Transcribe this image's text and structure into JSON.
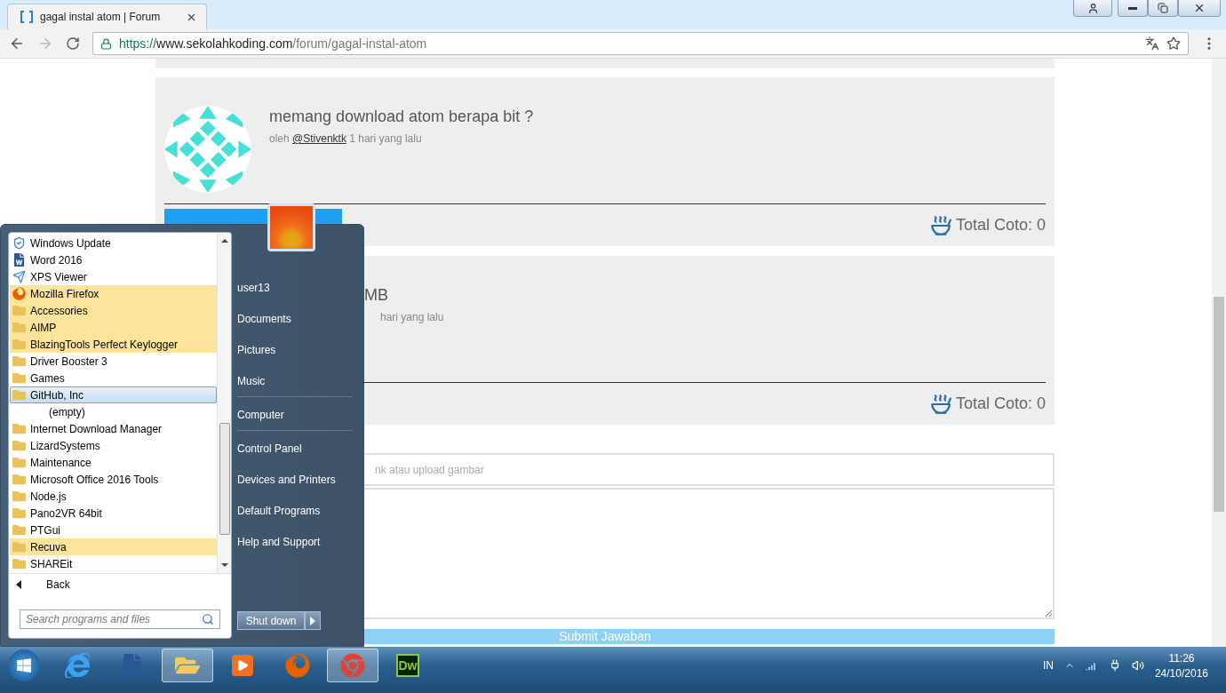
{
  "browser": {
    "tab": {
      "title": "gagal instal atom | Forum"
    },
    "url": {
      "scheme": "https://",
      "host": "www.sekolahkoding.com",
      "path": "/forum/gagal-instal-atom"
    }
  },
  "posts": [
    {
      "title": "memang download atom berapa bit ?",
      "by": "oleh",
      "author": "@Stivenktk",
      "time": "1 hari yang lalu",
      "coto": "Total Coto: 0"
    },
    {
      "title": "MB",
      "time": "hari yang lalu",
      "coto": "Total Coto: 0"
    }
  ],
  "reply_form": {
    "link_placeholder": "nk atau upload gambar",
    "submit": "Submit Jawaban"
  },
  "start_menu": {
    "programs": [
      {
        "label": "Windows Update",
        "kind": "update",
        "highlighted": false,
        "selected": false
      },
      {
        "label": "Word 2016",
        "kind": "word",
        "highlighted": false,
        "selected": false
      },
      {
        "label": "XPS Viewer",
        "kind": "xps",
        "highlighted": false,
        "selected": false
      },
      {
        "label": "Mozilla Firefox",
        "kind": "firefox",
        "highlighted": true,
        "selected": false
      },
      {
        "label": "Accessories",
        "kind": "folder",
        "highlighted": true,
        "selected": false
      },
      {
        "label": "AIMP",
        "kind": "folder",
        "highlighted": true,
        "selected": false
      },
      {
        "label": "BlazingTools Perfect Keylogger",
        "kind": "folder",
        "highlighted": true,
        "selected": false
      },
      {
        "label": "Driver Booster 3",
        "kind": "folder",
        "highlighted": false,
        "selected": false
      },
      {
        "label": "Games",
        "kind": "folder",
        "highlighted": false,
        "selected": false
      },
      {
        "label": "GitHub, Inc",
        "kind": "folder",
        "highlighted": false,
        "selected": true,
        "children": [
          {
            "label": "(empty)"
          }
        ]
      },
      {
        "label": "Internet Download Manager",
        "kind": "folder",
        "highlighted": false,
        "selected": false
      },
      {
        "label": "LizardSystems",
        "kind": "folder",
        "highlighted": false,
        "selected": false
      },
      {
        "label": "Maintenance",
        "kind": "folder",
        "highlighted": false,
        "selected": false
      },
      {
        "label": "Microsoft Office 2016 Tools",
        "kind": "folder",
        "highlighted": false,
        "selected": false
      },
      {
        "label": "Node.js",
        "kind": "folder",
        "highlighted": false,
        "selected": false
      },
      {
        "label": "Pano2VR 64bit",
        "kind": "folder",
        "highlighted": false,
        "selected": false
      },
      {
        "label": "PTGui",
        "kind": "folder",
        "highlighted": false,
        "selected": false
      },
      {
        "label": "Recuva",
        "kind": "folder",
        "highlighted": true,
        "selected": false
      },
      {
        "label": "SHAREit",
        "kind": "folder",
        "highlighted": false,
        "selected": false
      }
    ],
    "back": "Back",
    "search_placeholder": "Search programs and files",
    "places": [
      {
        "label": "user13",
        "separator_after": false
      },
      {
        "label": "Documents",
        "separator_after": false
      },
      {
        "label": "Pictures",
        "separator_after": false
      },
      {
        "label": "Music",
        "separator_after": true
      },
      {
        "label": "Computer",
        "separator_after": true
      },
      {
        "label": "Control Panel",
        "separator_after": false
      },
      {
        "label": "Devices and Printers",
        "separator_after": false
      },
      {
        "label": "Default Programs",
        "separator_after": false
      },
      {
        "label": "Help and Support",
        "separator_after": false
      }
    ],
    "shutdown": "Shut down"
  },
  "taskbar": {
    "apps": [
      {
        "kind": "ie",
        "active": false
      },
      {
        "kind": "word",
        "active": false
      },
      {
        "kind": "explorer",
        "active": true
      },
      {
        "kind": "media",
        "active": false
      },
      {
        "kind": "firefox",
        "active": false
      },
      {
        "kind": "chrome",
        "active": true
      },
      {
        "kind": "dreamweaver",
        "active": false,
        "label": "Dw"
      }
    ],
    "language": "IN",
    "time": "11:26",
    "date": "24/10/2016"
  }
}
